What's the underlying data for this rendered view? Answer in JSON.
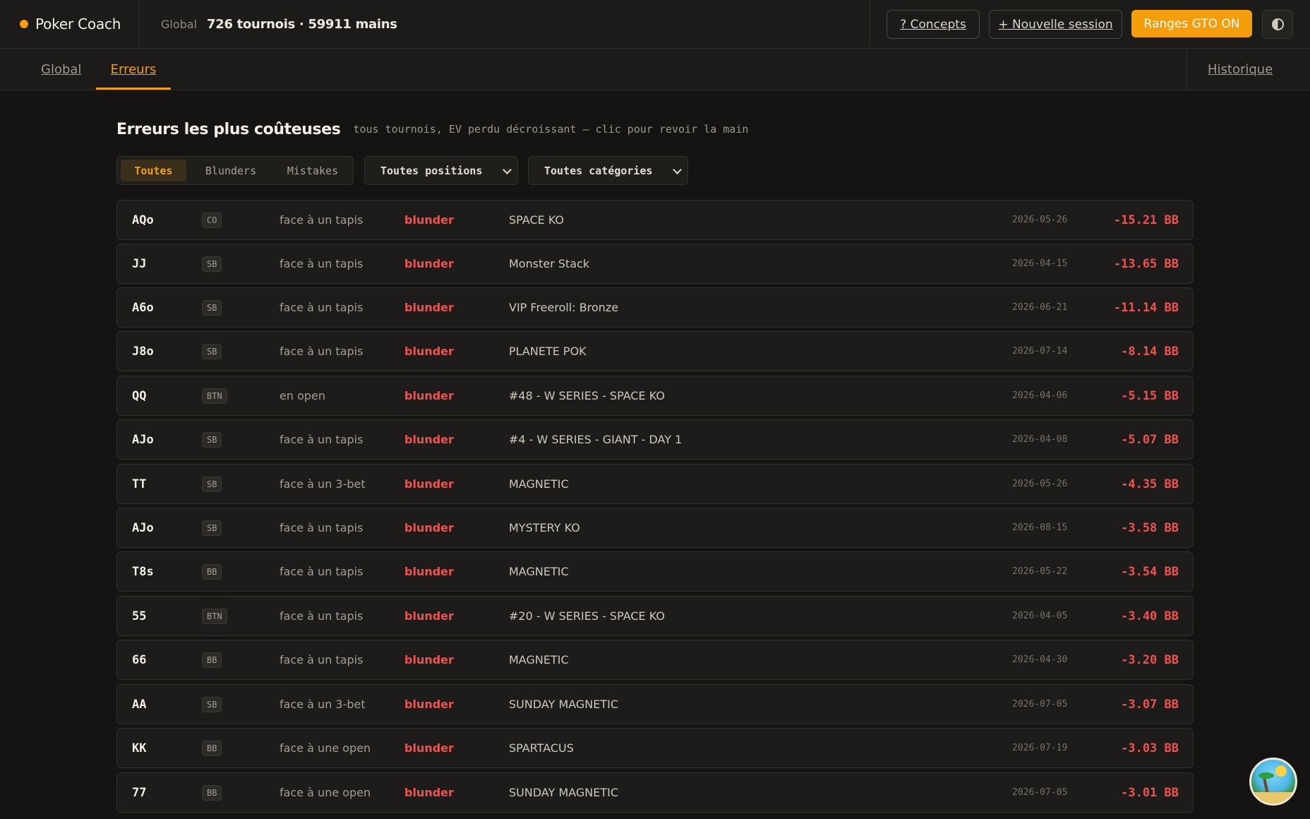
{
  "header": {
    "app_name": "Poker Coach",
    "scope_label": "Global",
    "stats": "726 tournois · 59911 mains",
    "concepts_label": "? Concepts",
    "new_session_label": "+ Nouvelle session",
    "gto_label": "Ranges GTO ON",
    "accent_color": "#f59e0b"
  },
  "tabs": {
    "global": "Global",
    "errors": "Erreurs",
    "history": "Historique",
    "active": "Erreurs"
  },
  "section": {
    "title": "Erreurs les plus coûteuses",
    "subtitle": "tous tournois, EV perdu décroissant — clic pour revoir la main"
  },
  "filters": {
    "severity": [
      "Toutes",
      "Blunders",
      "Mistakes"
    ],
    "severity_selected": "Toutes",
    "position_select": "Toutes positions",
    "category_select": "Toutes catégories"
  },
  "errors": [
    {
      "hand": "AQo",
      "pos": "CO",
      "category": "face à un tapis",
      "severity": "blunder",
      "tournament": "SPACE KO",
      "date": "2026-05-26",
      "ev": "-15.21 BB"
    },
    {
      "hand": "JJ",
      "pos": "SB",
      "category": "face à un tapis",
      "severity": "blunder",
      "tournament": "Monster Stack",
      "date": "2026-04-15",
      "ev": "-13.65 BB"
    },
    {
      "hand": "A6o",
      "pos": "SB",
      "category": "face à un tapis",
      "severity": "blunder",
      "tournament": "VIP Freeroll: Bronze",
      "date": "2026-06-21",
      "ev": "-11.14 BB"
    },
    {
      "hand": "J8o",
      "pos": "SB",
      "category": "face à un tapis",
      "severity": "blunder",
      "tournament": "PLANETE POK",
      "date": "2026-07-14",
      "ev": "-8.14 BB"
    },
    {
      "hand": "QQ",
      "pos": "BTN",
      "category": "en open",
      "severity": "blunder",
      "tournament": "#48 - W SERIES - SPACE KO",
      "date": "2026-04-06",
      "ev": "-5.15 BB"
    },
    {
      "hand": "AJo",
      "pos": "SB",
      "category": "face à un tapis",
      "severity": "blunder",
      "tournament": "#4 - W SERIES - GIANT - DAY 1",
      "date": "2026-04-08",
      "ev": "-5.07 BB"
    },
    {
      "hand": "TT",
      "pos": "SB",
      "category": "face à un 3-bet",
      "severity": "blunder",
      "tournament": "MAGNETIC",
      "date": "2026-05-26",
      "ev": "-4.35 BB"
    },
    {
      "hand": "AJo",
      "pos": "SB",
      "category": "face à un tapis",
      "severity": "blunder",
      "tournament": "MYSTERY KO",
      "date": "2026-08-15",
      "ev": "-3.58 BB"
    },
    {
      "hand": "T8s",
      "pos": "BB",
      "category": "face à un tapis",
      "severity": "blunder",
      "tournament": "MAGNETIC",
      "date": "2026-05-22",
      "ev": "-3.54 BB"
    },
    {
      "hand": "55",
      "pos": "BTN",
      "category": "face à un tapis",
      "severity": "blunder",
      "tournament": "#20 - W SERIES - SPACE KO",
      "date": "2026-04-05",
      "ev": "-3.40 BB"
    },
    {
      "hand": "66",
      "pos": "BB",
      "category": "face à un tapis",
      "severity": "blunder",
      "tournament": "MAGNETIC",
      "date": "2026-04-30",
      "ev": "-3.20 BB"
    },
    {
      "hand": "AA",
      "pos": "SB",
      "category": "face à un 3-bet",
      "severity": "blunder",
      "tournament": "SUNDAY MAGNETIC",
      "date": "2026-07-05",
      "ev": "-3.07 BB"
    },
    {
      "hand": "KK",
      "pos": "BB",
      "category": "face à une open",
      "severity": "blunder",
      "tournament": "SPARTACUS",
      "date": "2026-07-19",
      "ev": "-3.03 BB"
    },
    {
      "hand": "77",
      "pos": "BB",
      "category": "face à une open",
      "severity": "blunder",
      "tournament": "SUNDAY MAGNETIC",
      "date": "2026-07-05",
      "ev": "-3.01 BB"
    }
  ]
}
